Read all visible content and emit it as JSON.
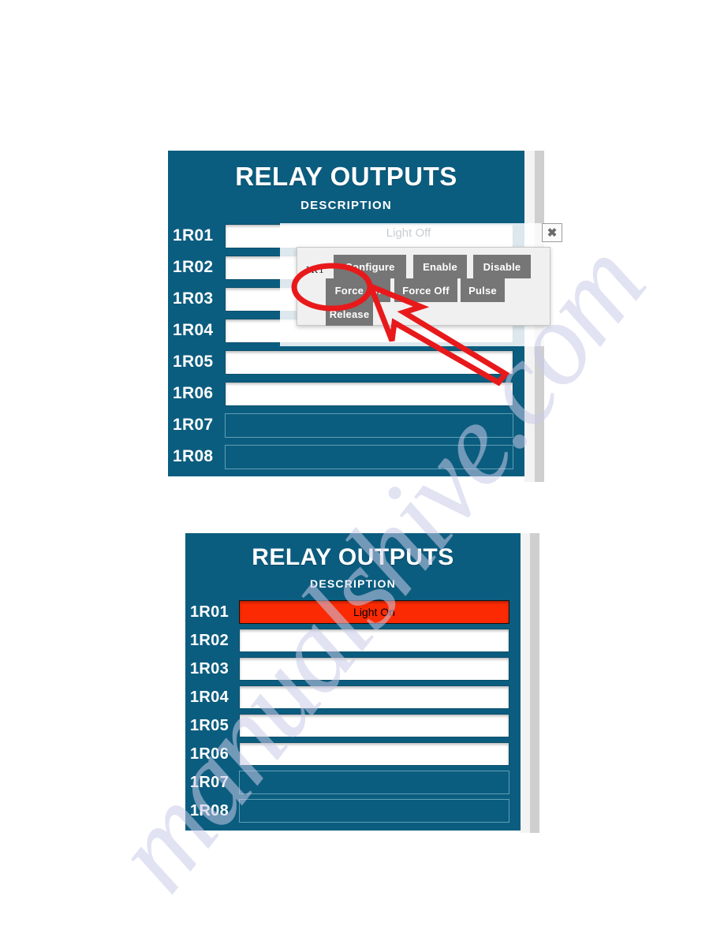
{
  "watermark": {
    "text": "manualshive.com"
  },
  "panel1": {
    "title": "RELAY OUTPUTS",
    "subtitle": "DESCRIPTION",
    "rows": [
      {
        "label": "1R01",
        "value": "",
        "state": "empty"
      },
      {
        "label": "1R02",
        "value": "",
        "state": "empty"
      },
      {
        "label": "1R03",
        "value": "",
        "state": "empty"
      },
      {
        "label": "1R04",
        "value": "",
        "state": "empty"
      },
      {
        "label": "1R05",
        "value": "",
        "state": "empty"
      },
      {
        "label": "1R06",
        "value": "",
        "state": "empty"
      },
      {
        "label": "1R07",
        "value": "",
        "state": "disabled"
      },
      {
        "label": "1R08",
        "value": "",
        "state": "disabled"
      }
    ],
    "ghost_value": "Light Off",
    "close_label": "✖"
  },
  "popup": {
    "point_id": "1R1",
    "buttons": [
      {
        "key": "configure",
        "label": "Configure"
      },
      {
        "key": "enable",
        "label": "Enable"
      },
      {
        "key": "disable",
        "label": "Disable"
      },
      {
        "key": "force_on",
        "label": "Force On"
      },
      {
        "key": "force_off",
        "label": "Force Off"
      },
      {
        "key": "pulse",
        "label": "Pulse"
      },
      {
        "key": "release",
        "label": "Release"
      }
    ]
  },
  "annotation": {
    "color": "#e8191b",
    "highlight_target": "Force On"
  },
  "panel2": {
    "title": "RELAY OUTPUTS",
    "subtitle": "DESCRIPTION",
    "rows": [
      {
        "label": "1R01",
        "value": "Light On",
        "state": "active"
      },
      {
        "label": "1R02",
        "value": "",
        "state": "empty"
      },
      {
        "label": "1R03",
        "value": "",
        "state": "empty"
      },
      {
        "label": "1R04",
        "value": "",
        "state": "empty"
      },
      {
        "label": "1R05",
        "value": "",
        "state": "empty"
      },
      {
        "label": "1R06",
        "value": "",
        "state": "empty"
      },
      {
        "label": "1R07",
        "value": "",
        "state": "disabled"
      },
      {
        "label": "1R08",
        "value": "",
        "state": "disabled"
      }
    ]
  },
  "colors": {
    "panel_bg": "#0b5d7f",
    "active_row": "#fb2a02",
    "button_gray": "#767676",
    "annotation_red": "#e8191b"
  }
}
